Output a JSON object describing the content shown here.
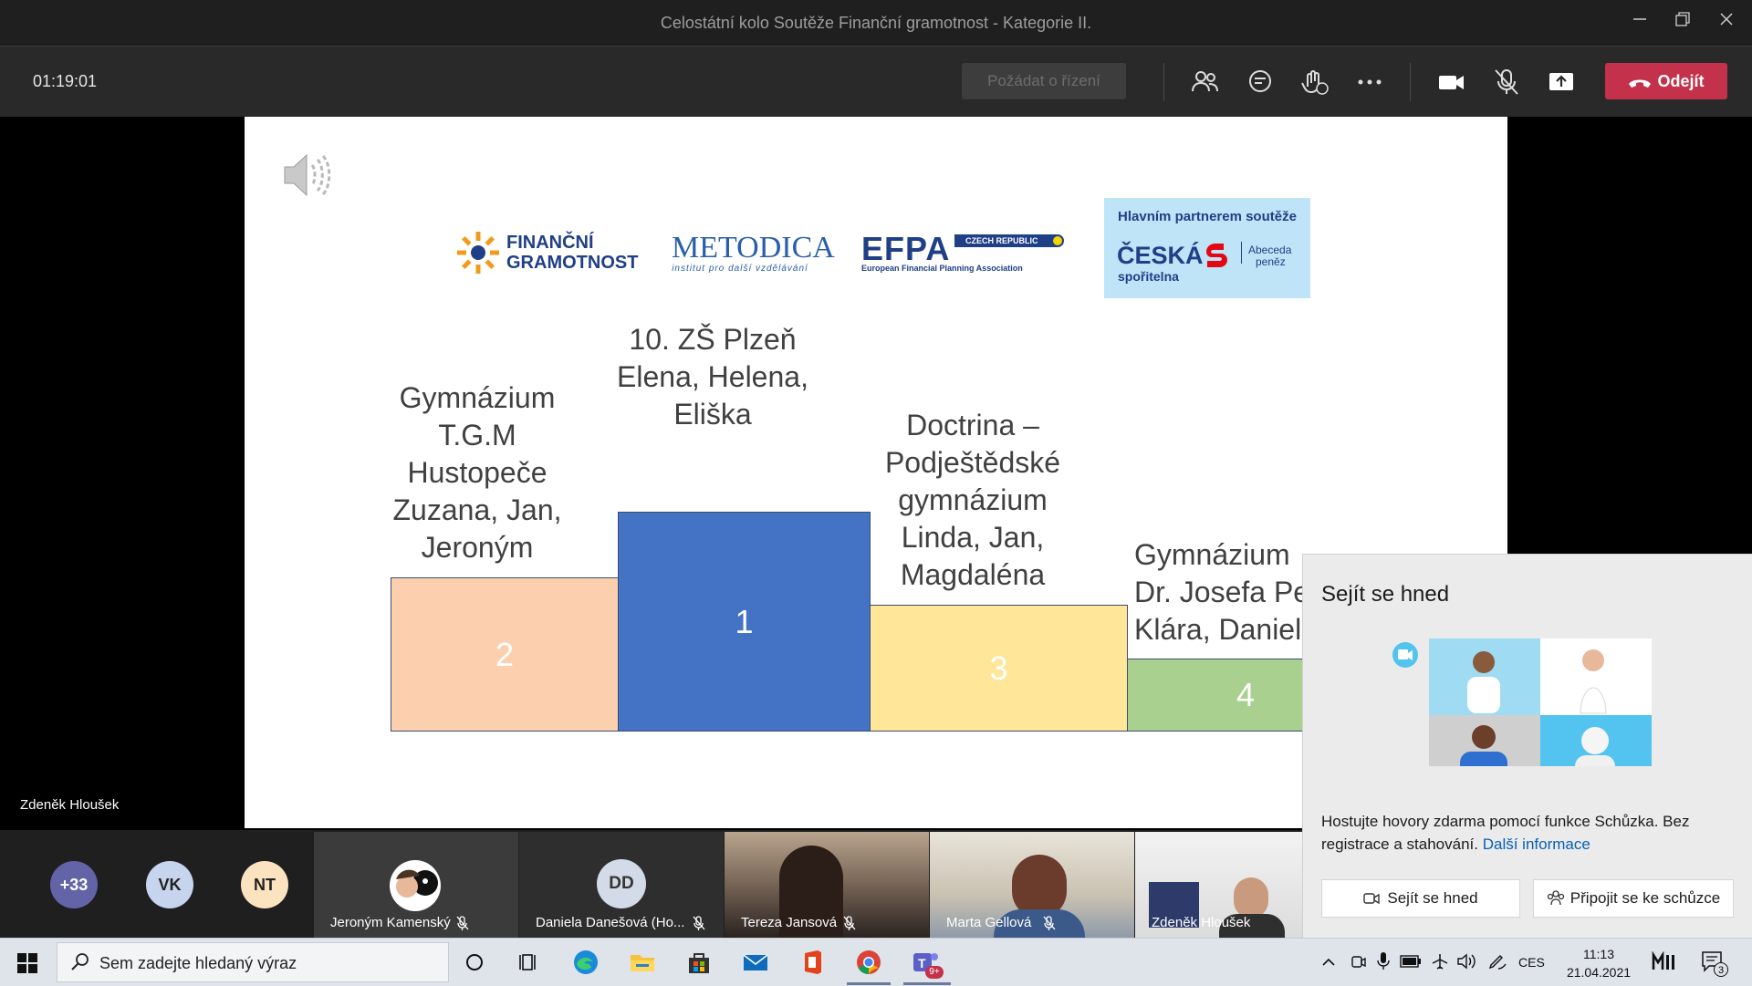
{
  "window": {
    "title": "Celostátní kolo Soutěže Finanční gramotnost - Kategorie II."
  },
  "toolbar": {
    "timer": "01:19:01",
    "request_control_label": "Požádat o řízení",
    "leave_label": "Odejít",
    "accent_leave": "#c4314b"
  },
  "presenter": {
    "name": "Zdeněk Hloušek"
  },
  "slide": {
    "logos": {
      "fg_line1": "FINANČNÍ",
      "fg_line2": "GRAMOTNOST",
      "metodica": "METODICA",
      "metodica_sub": "institut pro další vzdělávání",
      "efpa": "EFPA",
      "efpa_badge": "CZECH REPUBLIC",
      "efpa_sub": "European Financial Planning Association",
      "partner_heading": "Hlavním partnerem soutěže",
      "cs_name": "ČESKÁ",
      "cs_sub": "spořitelna",
      "cs_abeceda": "Abeceda",
      "cs_penez": "peněz"
    },
    "podium": [
      {
        "place": "2",
        "label": "Gymnázium\nT.G.M\nHustopeče\nZuzana, Jan,\nJeroným",
        "color": "#fccfae"
      },
      {
        "place": "1",
        "label": "10. ZŠ Plzeň\nElena, Helena,\nEliška",
        "color": "#4472c4"
      },
      {
        "place": "3",
        "label": "Doctrina –\nPodještědské\ngymnázium\nLinda, Jan,\nMagdaléna",
        "color": "#ffe699"
      },
      {
        "place": "4",
        "label": "Gymnázium\nDr. Josefa Pek\nKlára, Daniel,",
        "color": "#a9d08e"
      }
    ]
  },
  "participants": {
    "avatars": [
      {
        "text": "+33",
        "color": "#6264a7"
      },
      {
        "text": "VK",
        "color": "#c7d4ee"
      },
      {
        "text": "NT",
        "color": "#fbe3bf"
      }
    ],
    "tiles": [
      {
        "name": "Jeroným Kamenský"
      },
      {
        "name": "Daniela Danešová (Ho...",
        "initials": "DD"
      },
      {
        "name": "Tereza Jansová"
      },
      {
        "name": "Marta Gellová"
      },
      {
        "name": "Zdeněk Hloušek"
      }
    ]
  },
  "popup": {
    "title": "Sejít se hned",
    "description": "Hostujte hovory zdarma pomocí funkce Schůzka. Bez registrace a stahování.",
    "link": "Další informace",
    "meet_now_button": "Sejít se hned",
    "join_button": "Připojit se ke schůzce"
  },
  "taskbar": {
    "search_placeholder": "Sem zadejte hledaný výraz",
    "teams_badge": "9+",
    "language": "CES",
    "time": "11:13",
    "date": "21.04.2021",
    "notifications": "3"
  }
}
